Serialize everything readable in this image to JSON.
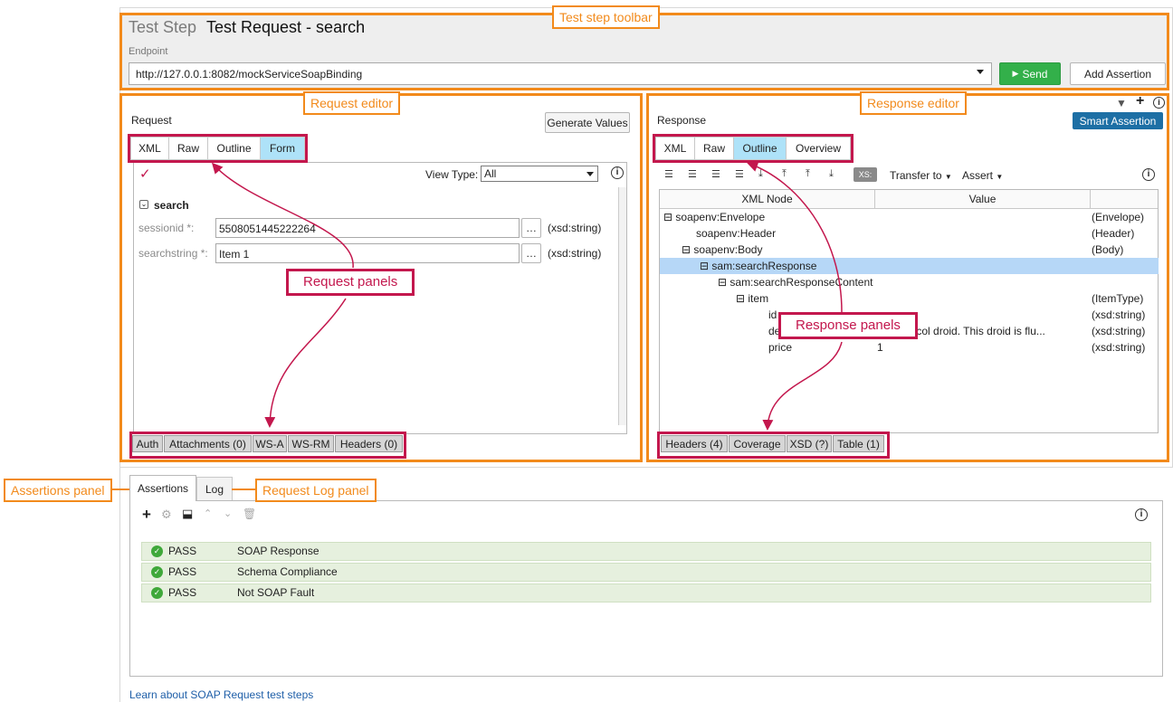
{
  "toolbar": {
    "kind": "Test Step",
    "title": "Test Request - search",
    "endpoint_label": "Endpoint",
    "endpoint_value": "http://127.0.0.1:8082/mockServiceSoapBinding",
    "send": "Send",
    "add_assertion": "Add Assertion"
  },
  "request": {
    "label": "Request",
    "generate_values": "Generate Values",
    "tabs": [
      "XML",
      "Raw",
      "Outline",
      "Form"
    ],
    "active_tab": "Form",
    "view_type_label": "View Type:",
    "view_type_value": "All",
    "operation": "search",
    "fields": [
      {
        "label": "sessionid *:",
        "value": "5508051445222264",
        "type": "(xsd:string)"
      },
      {
        "label": "searchstring *:",
        "value": "Item 1",
        "type": "(xsd:string)"
      }
    ],
    "bottom_tabs": [
      "Auth",
      "Attachments (0)",
      "WS-A",
      "WS-RM",
      "Headers (0)"
    ]
  },
  "response": {
    "label": "Response",
    "smart_assertion": "Smart Assertion",
    "tabs": [
      "XML",
      "Raw",
      "Outline",
      "Overview"
    ],
    "active_tab": "Outline",
    "transfer_to": "Transfer to",
    "assert": "Assert",
    "xs_badge": "XS:",
    "columns": [
      "XML Node",
      "Value",
      ""
    ],
    "tree": [
      {
        "node": "soapenv:Envelope",
        "value": "",
        "type": "(Envelope)"
      },
      {
        "node": "soapenv:Header",
        "value": "",
        "type": "(Header)"
      },
      {
        "node": "soapenv:Body",
        "value": "",
        "type": "(Body)"
      },
      {
        "node": "sam:searchResponse",
        "value": "",
        "type": ""
      },
      {
        "node": "sam:searchResponseContent",
        "value": "",
        "type": ""
      },
      {
        "node": "item",
        "value": "",
        "type": "(ItemType)"
      },
      {
        "node": "id",
        "value": "",
        "type": "(xsd:string)"
      },
      {
        "node": "de",
        "value": "dy protocol droid. This droid is flu...",
        "type": "(xsd:string)"
      },
      {
        "node": "price",
        "value": "1",
        "type": "(xsd:string)"
      }
    ],
    "bottom_tabs": [
      "Headers (4)",
      "Coverage",
      "XSD (?)",
      "Table (1)"
    ]
  },
  "assertions": {
    "tabs": [
      "Assertions",
      "Log"
    ],
    "active_tab": "Assertions",
    "rows": [
      {
        "status": "PASS",
        "name": "SOAP Response"
      },
      {
        "status": "PASS",
        "name": "Schema Compliance"
      },
      {
        "status": "PASS",
        "name": "Not SOAP Fault"
      }
    ]
  },
  "footer_link": "Learn about SOAP Request test steps",
  "annotations": {
    "test_step_toolbar": "Test step toolbar",
    "request_editor": "Request editor",
    "response_editor": "Response editor",
    "request_panels": "Request panels",
    "response_panels": "Response panels",
    "assertions_panel": "Assertions panel",
    "request_log_panel": "Request Log panel"
  },
  "colors": {
    "annotation_orange": "#f28a1b",
    "annotation_red": "#c3174d",
    "active_tab": "#aee2f8",
    "send_green": "#33b04a",
    "smart_assertion_blue": "#1d6fa5",
    "pass_row": "#e6f0de",
    "link_blue": "#1f5fa8"
  }
}
